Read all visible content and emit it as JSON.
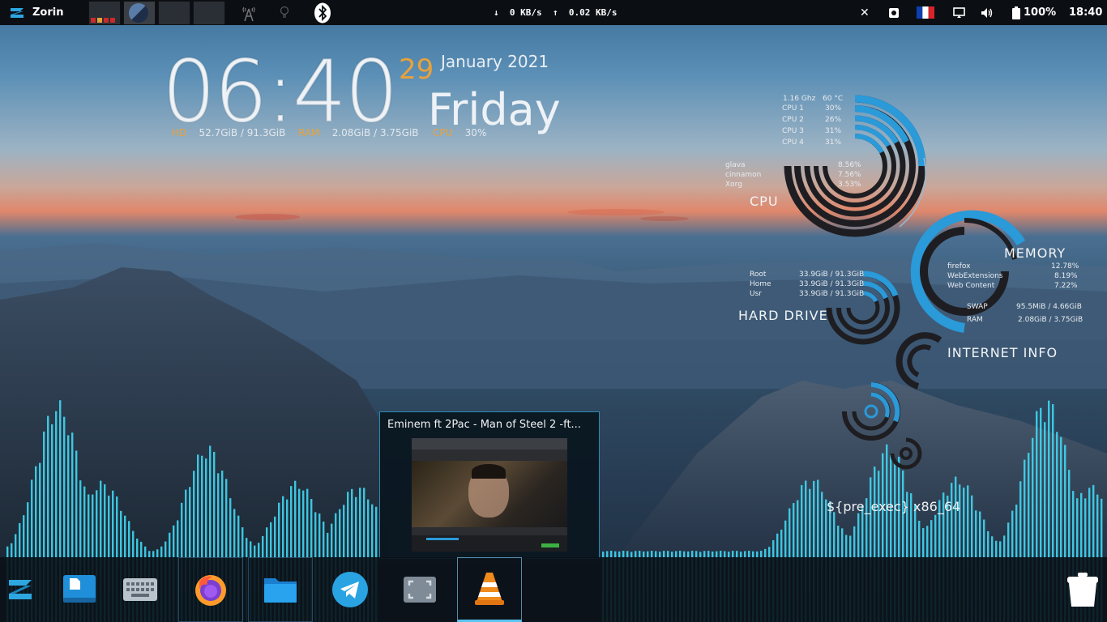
{
  "top_panel": {
    "menu_label": "Zorin",
    "net_down": "0 KB/s",
    "net_up": "0.02 KB/s",
    "battery": "100%",
    "time": "18:40",
    "close_glyph": "✕"
  },
  "clock_widget": {
    "time": "06:40",
    "day": "29",
    "month_year": "January 2021",
    "weekday": "Friday",
    "hd_label": "HD",
    "hd_value": "52.7GiB / 91.3GiB",
    "ram_label": "RAM",
    "ram_value": "2.08GiB / 3.75GiB",
    "cpu_label": "CPU",
    "cpu_value": "30%"
  },
  "conky": {
    "cpu": {
      "label": "CPU",
      "freq": "1.16 Ghz",
      "temp": "60 °C",
      "cores": [
        {
          "name": "CPU 1",
          "value": "30%"
        },
        {
          "name": "CPU 2",
          "value": "26%"
        },
        {
          "name": "CPU 3",
          "value": "31%"
        },
        {
          "name": "CPU 4",
          "value": "31%"
        }
      ],
      "processes": [
        {
          "name": "glava",
          "value": "8.56%"
        },
        {
          "name": "cinnamon",
          "value": "7.56%"
        },
        {
          "name": "Xorg",
          "value": "3.53%"
        }
      ]
    },
    "memory": {
      "label": "MEMORY",
      "processes": [
        {
          "name": "firefox",
          "value": "12.78%"
        },
        {
          "name": "WebExtensions",
          "value": "8.19%"
        },
        {
          "name": "Web Content",
          "value": "7.22%"
        }
      ],
      "swap_label": "SWAP",
      "swap_value": "95.5MiB / 4.66GiB",
      "ram_label": "RAM",
      "ram_value": "2.08GiB / 3.75GiB"
    },
    "hard_drive": {
      "label": "HARD DRIVE",
      "rows": [
        {
          "name": "Root",
          "value": "33.9GiB / 91.3GiB"
        },
        {
          "name": "Home",
          "value": "33.9GiB / 91.3GiB"
        },
        {
          "name": "Usr",
          "value": "33.9GiB / 91.3GiB"
        }
      ]
    },
    "internet_label": "INTERNET INFO",
    "arch_text": "${pre_exec} x86_64"
  },
  "preview": {
    "title": "Eminem ft 2Pac - Man of Steel 2 -ft..."
  },
  "dock": {
    "items": [
      {
        "name": "zorin-menu-icon"
      },
      {
        "name": "text-editor-icon"
      },
      {
        "name": "keyboard-icon"
      },
      {
        "name": "firefox-icon"
      },
      {
        "name": "files-icon"
      },
      {
        "name": "telegram-icon"
      },
      {
        "name": "screenshot-icon"
      },
      {
        "name": "vlc-icon"
      },
      {
        "name": "trash-icon"
      }
    ]
  },
  "colors": {
    "accent": "#2a9ad9",
    "clock_orange": "#e8a23a",
    "visualizer": "#3fd7f2"
  }
}
